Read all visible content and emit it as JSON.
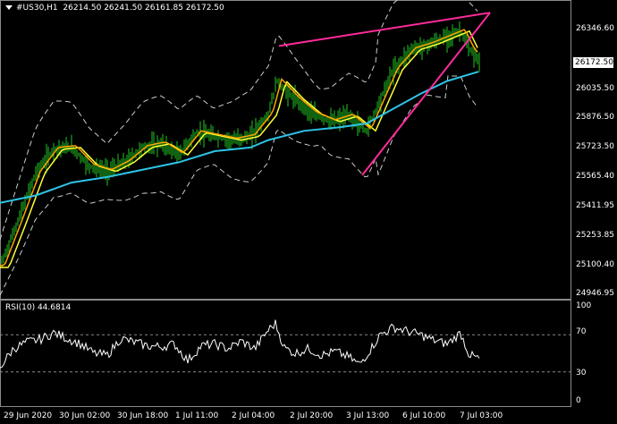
{
  "main_header": {
    "menu_icon": "triangle-down-icon",
    "symbol": "#US30,H1",
    "ohlc": "26214.50 26241.50 26161.85 26172.50"
  },
  "rsi_header": {
    "label": "RSI(10) 44.6814"
  },
  "current_price": "26172.50",
  "price_axis": [
    "26346.60",
    "26172.50",
    "26035.50",
    "25876.50",
    "25723.50",
    "25565.40",
    "25411.95",
    "25253.85",
    "25100.40",
    "24946.95"
  ],
  "rsi_axis": [
    "100",
    "70",
    "30",
    "0"
  ],
  "time_axis": [
    "29 Jun 2020",
    "30 Jun 02:00",
    "30 Jun 18:00",
    "1 Jul 11:00",
    "2 Jul 04:00",
    "2 Jul 20:00",
    "3 Jul 13:00",
    "6 Jul 10:00",
    "7 Jul 03:00"
  ],
  "colors": {
    "background": "#000000",
    "candles": "#22c322",
    "ma_fast": "#ffa500",
    "ma_mid": "#ffff33",
    "ma_slow": "#2ec4e6",
    "bollinger": "#cccccc",
    "wedge": "#ff2b9a",
    "rsi_line": "#ffffff",
    "price_tag_bg": "#ffffff"
  },
  "chart_data": {
    "type": "line",
    "title": "#US30,H1",
    "ylim": [
      24900,
      26460
    ],
    "x": [
      "29 Jun 2020",
      "30 Jun 02:00",
      "30 Jun 18:00",
      "1 Jul 11:00",
      "2 Jul 04:00",
      "2 Jul 20:00",
      "3 Jul 13:00",
      "6 Jul 10:00",
      "7 Jul 03:00"
    ],
    "price_close": [
      [
        0,
        25050
      ],
      [
        20,
        25300
      ],
      [
        40,
        25560
      ],
      [
        60,
        25690
      ],
      [
        80,
        25700
      ],
      [
        100,
        25600
      ],
      [
        120,
        25570
      ],
      [
        140,
        25620
      ],
      [
        160,
        25700
      ],
      [
        180,
        25720
      ],
      [
        200,
        25660
      ],
      [
        220,
        25780
      ],
      [
        240,
        25760
      ],
      [
        260,
        25740
      ],
      [
        280,
        25760
      ],
      [
        300,
        25880
      ],
      [
        310,
        26060
      ],
      [
        330,
        25960
      ],
      [
        350,
        25880
      ],
      [
        370,
        25840
      ],
      [
        390,
        25870
      ],
      [
        410,
        25790
      ],
      [
        420,
        25900
      ],
      [
        440,
        26120
      ],
      [
        460,
        26230
      ],
      [
        480,
        26260
      ],
      [
        500,
        26300
      ],
      [
        515,
        26330
      ],
      [
        525,
        26230
      ],
      [
        535,
        26172.5
      ]
    ],
    "ma_slow": [
      [
        0,
        25400
      ],
      [
        40,
        25440
      ],
      [
        80,
        25510
      ],
      [
        120,
        25540
      ],
      [
        160,
        25580
      ],
      [
        200,
        25620
      ],
      [
        240,
        25680
      ],
      [
        280,
        25700
      ],
      [
        300,
        25740
      ],
      [
        340,
        25790
      ],
      [
        380,
        25810
      ],
      [
        410,
        25830
      ],
      [
        440,
        25910
      ],
      [
        470,
        25990
      ],
      [
        500,
        26060
      ],
      [
        535,
        26110
      ]
    ],
    "wedge_upper": [
      [
        312,
        26250
      ],
      [
        548,
        26430
      ]
    ],
    "wedge_lower": [
      [
        405,
        25550
      ],
      [
        535,
        26310
      ]
    ],
    "rsi": {
      "period": 10,
      "last": 44.6814,
      "levels": [
        70,
        30
      ],
      "ylim": [
        0,
        100
      ],
      "values": [
        [
          0,
          35
        ],
        [
          15,
          55
        ],
        [
          30,
          62
        ],
        [
          45,
          65
        ],
        [
          60,
          72
        ],
        [
          75,
          66
        ],
        [
          90,
          60
        ],
        [
          105,
          50
        ],
        [
          120,
          48
        ],
        [
          135,
          66
        ],
        [
          150,
          62
        ],
        [
          165,
          58
        ],
        [
          180,
          57
        ],
        [
          195,
          60
        ],
        [
          210,
          42
        ],
        [
          225,
          58
        ],
        [
          240,
          60
        ],
        [
          255,
          55
        ],
        [
          270,
          63
        ],
        [
          285,
          55
        ],
        [
          300,
          75
        ],
        [
          308,
          82
        ],
        [
          318,
          56
        ],
        [
          330,
          50
        ],
        [
          345,
          55
        ],
        [
          360,
          48
        ],
        [
          375,
          52
        ],
        [
          390,
          46
        ],
        [
          402,
          38
        ],
        [
          415,
          55
        ],
        [
          425,
          70
        ],
        [
          440,
          78
        ],
        [
          455,
          74
        ],
        [
          470,
          70
        ],
        [
          485,
          64
        ],
        [
          500,
          60
        ],
        [
          515,
          72
        ],
        [
          525,
          48
        ],
        [
          535,
          44.68
        ]
      ]
    }
  }
}
